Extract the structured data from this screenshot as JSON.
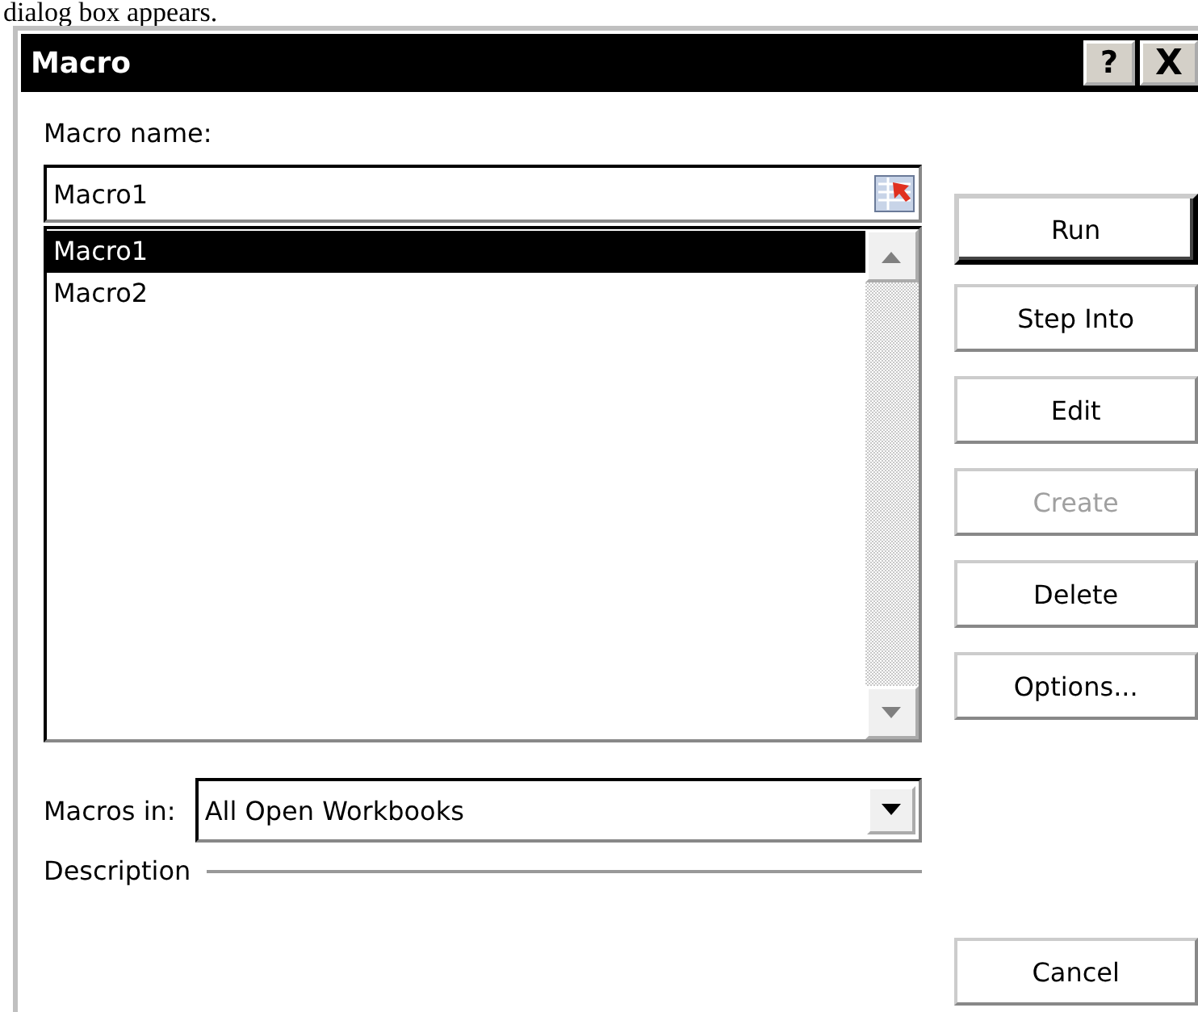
{
  "page_text": "dialog box appears.",
  "window": {
    "title": "Macro",
    "title_buttons": [
      {
        "kind": "help",
        "label": "?"
      },
      {
        "kind": "close",
        "label": "X"
      }
    ]
  },
  "macro_name": {
    "label": "Macro name:",
    "value": "Macro1"
  },
  "macro_list": [
    {
      "label": "Macro1",
      "selected": true
    },
    {
      "label": "Macro2",
      "selected": false
    }
  ],
  "macros_in": {
    "label": "Macros in:",
    "value": "All Open Workbooks"
  },
  "description": {
    "label": "Description"
  },
  "buttons": [
    {
      "label": "Run",
      "default": true,
      "disabled": false
    },
    {
      "label": "Step Into",
      "default": false,
      "disabled": false
    },
    {
      "label": "Edit",
      "default": false,
      "disabled": false
    },
    {
      "label": "Create",
      "default": false,
      "disabled": true
    },
    {
      "label": "Delete",
      "default": false,
      "disabled": false
    },
    {
      "label": "Options...",
      "default": false,
      "disabled": false
    }
  ],
  "cancel_button": {
    "label": "Cancel"
  }
}
